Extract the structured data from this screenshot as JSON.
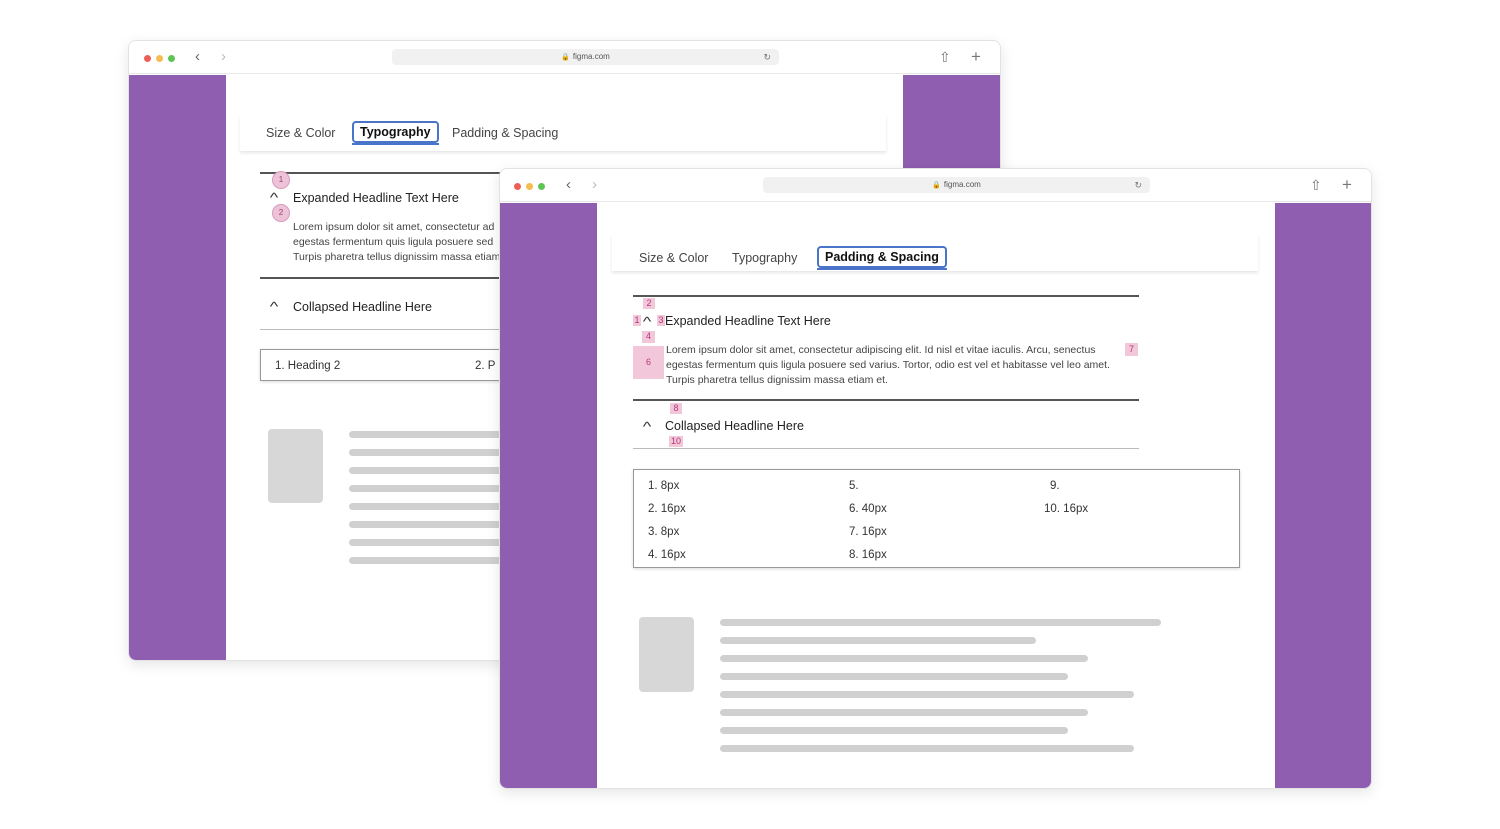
{
  "browser": {
    "url": "figma.com",
    "traffic_colors": [
      "#ec5f57",
      "#f5bd4f",
      "#5ec454"
    ],
    "back_glyph": "‹",
    "forward_glyph": "›",
    "lock_glyph": "🔒",
    "reload_glyph": "↻",
    "share_glyph": "⇧",
    "new_tab_glyph": "+"
  },
  "colors": {
    "sidebar": "#8f5eb0",
    "active_tab_border": "#4a74c9",
    "annotation": "#ecc3d9"
  },
  "back_window": {
    "tabs": [
      {
        "label": "Size & Color",
        "active": false
      },
      {
        "label": "Typography",
        "active": true
      },
      {
        "label": "Padding & Spacing",
        "active": false
      }
    ],
    "expanded_headline": "Expanded Headline Text Here",
    "body_lines": [
      "Lorem ipsum dolor sit amet, consectetur ad",
      "egestas fermentum quis ligula posuere sed",
      "Turpis pharetra tellus dignissim massa etiam"
    ],
    "collapsed_headline": "Collapsed Headline Here",
    "annotations": [
      "1",
      "2"
    ],
    "legend_items": [
      "1.  Heading 2",
      "2.  P"
    ]
  },
  "front_window": {
    "tabs": [
      {
        "label": "Size & Color",
        "active": false
      },
      {
        "label": "Typography",
        "active": false
      },
      {
        "label": "Padding & Spacing",
        "active": true
      }
    ],
    "expanded_headline": "Expanded Headline Text Here",
    "body_lines": [
      "Lorem ipsum dolor sit amet, consectetur adipiscing elit. Id nisl et vitae iaculis. Arcu, senectus",
      "egestas fermentum quis ligula posuere sed varius. Tortor, odio est vel et habitasse vel leo amet.",
      "Turpis pharetra tellus dignissim massa etiam et."
    ],
    "collapsed_headline": "Collapsed Headline Here",
    "annotations": [
      "1",
      "2",
      "3",
      "4",
      "6",
      "7",
      "8",
      "10"
    ],
    "legend_items": [
      "1. 8px",
      "2. 16px",
      "3. 8px",
      "4. 16px",
      "5.",
      "6. 40px",
      "7. 16px",
      "8. 16px",
      "9.",
      "10. 16px"
    ]
  }
}
